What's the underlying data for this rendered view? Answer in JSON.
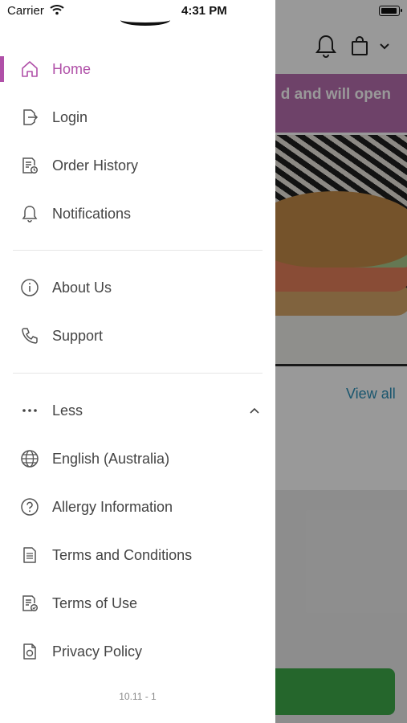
{
  "status_bar": {
    "carrier": "Carrier",
    "time": "4:31 PM"
  },
  "menu": {
    "primary": [
      {
        "label": "Home",
        "icon": "home-icon",
        "active": true
      },
      {
        "label": "Login",
        "icon": "login-icon"
      },
      {
        "label": "Order History",
        "icon": "order-history-icon"
      },
      {
        "label": "Notifications",
        "icon": "bell-icon"
      }
    ],
    "secondary": [
      {
        "label": "About Us",
        "icon": "info-icon"
      },
      {
        "label": "Support",
        "icon": "phone-icon"
      }
    ],
    "more": [
      {
        "label": "Less",
        "icon": "more-dots-icon",
        "expanded": true
      },
      {
        "label": "English (Australia)",
        "icon": "globe-icon"
      },
      {
        "label": "Allergy Information",
        "icon": "question-icon"
      },
      {
        "label": "Terms and Conditions",
        "icon": "document-icon"
      },
      {
        "label": "Terms of Use",
        "icon": "document-check-icon"
      },
      {
        "label": "Privacy Policy",
        "icon": "privacy-icon"
      }
    ]
  },
  "version": "10.11 - 1",
  "background": {
    "banner_text": "d and will open",
    "view_all": "View all"
  },
  "colors": {
    "accent": "#b050a8",
    "banner": "#b86fb0",
    "link": "#2a8fb8",
    "cta": "#3eaa4a"
  }
}
